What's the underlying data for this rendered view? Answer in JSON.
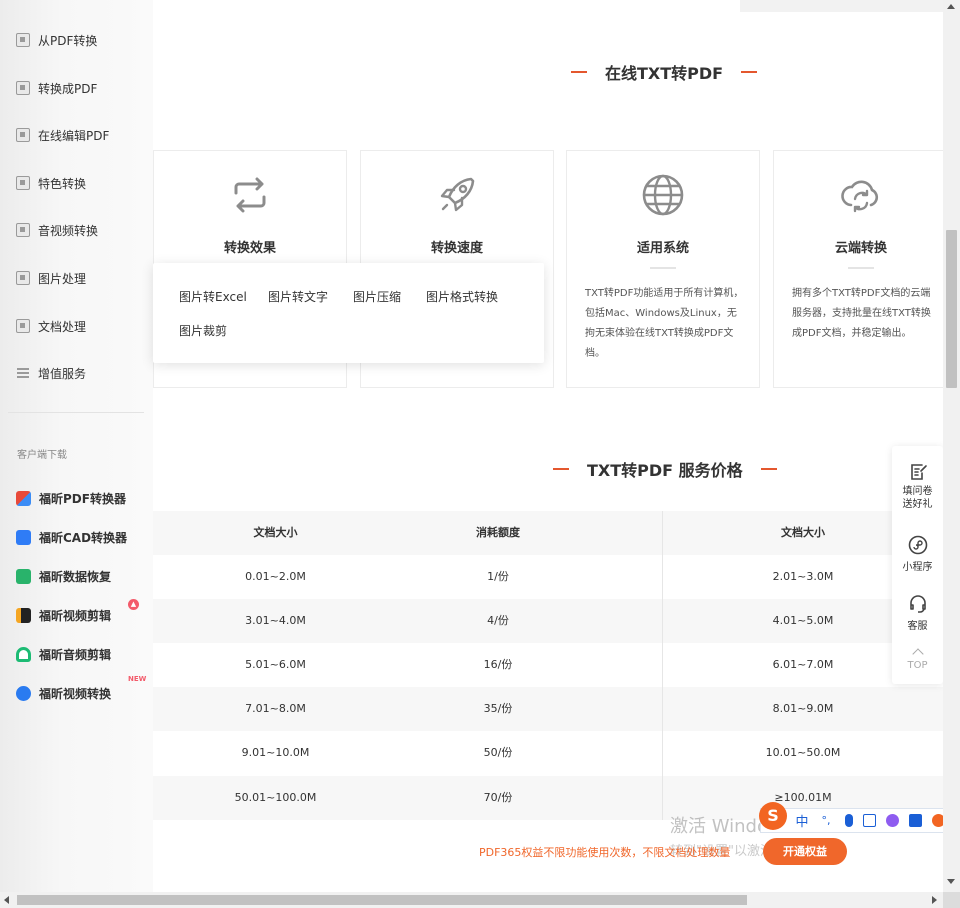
{
  "sidebar": {
    "menu": [
      {
        "label": "从PDF转换",
        "icon": "pdf-convert-icon"
      },
      {
        "label": "转换成PDF",
        "icon": "to-pdf-icon"
      },
      {
        "label": "在线编辑PDF",
        "icon": "edit-pdf-icon"
      },
      {
        "label": "特色转换",
        "icon": "special-convert-icon"
      },
      {
        "label": "音视频转换",
        "icon": "media-convert-icon"
      },
      {
        "label": "图片处理",
        "icon": "image-process-icon"
      },
      {
        "label": "文档处理",
        "icon": "document-process-icon"
      },
      {
        "label": "增值服务",
        "icon": "value-service-icon"
      }
    ],
    "download_caption": "客户端下载",
    "downloads": [
      {
        "label": "福昕PDF转换器",
        "color": "#e84a3a"
      },
      {
        "label": "福昕CAD转换器",
        "color": "#2f7cf6"
      },
      {
        "label": "福昕数据恢复",
        "color": "#29b36b"
      },
      {
        "label": "福昕视频剪辑",
        "color": "#222222",
        "badge": "hot"
      },
      {
        "label": "福昕音频剪辑",
        "color": "#1dbb74"
      },
      {
        "label": "福昕视频转换",
        "color": "#2a7bf0",
        "badge": "NEW"
      }
    ]
  },
  "section1": {
    "title": "在线TXT转PDF"
  },
  "cards": [
    {
      "title": "转换效果",
      "icon": "convert-arrows-icon",
      "desc": ""
    },
    {
      "title": "转换速度",
      "icon": "rocket-icon",
      "desc": ""
    },
    {
      "title": "适用系统",
      "icon": "globe-icon",
      "desc": "TXT转PDF功能适用于所有计算机，包括Mac、Windows及Linux，无拘无束体验在线TXT转换成PDF文档。"
    },
    {
      "title": "云端转换",
      "icon": "cloud-sync-icon",
      "desc": "拥有多个TXT转PDF文档的云端服务器，支持批量在线TXT转换成PDF文档，并稳定输出。"
    }
  ],
  "dropdown": {
    "items": [
      "图片转Excel",
      "图片转文字",
      "图片压缩",
      "图片格式转换",
      "图片裁剪"
    ]
  },
  "section2": {
    "title": "TXT转PDF 服务价格"
  },
  "price_table": {
    "headers": [
      "文档大小",
      "消耗额度",
      "文档大小"
    ],
    "rows": [
      [
        "0.01~2.0M",
        "1/份",
        "2.01~3.0M"
      ],
      [
        "3.01~4.0M",
        "4/份",
        "4.01~5.0M"
      ],
      [
        "5.01~6.0M",
        "16/份",
        "6.01~7.0M"
      ],
      [
        "7.01~8.0M",
        "35/份",
        "8.01~9.0M"
      ],
      [
        "9.01~10.0M",
        "50/份",
        "10.01~50.0M"
      ],
      [
        "50.01~100.0M",
        "70/份",
        "≥100.01M"
      ]
    ]
  },
  "promo": {
    "text": "PDF365权益不限功能使用次数，不限文档处理数量",
    "button": "开通权益"
  },
  "watermark": {
    "line1": "激活 Windows",
    "line2": "转到\"设置\"以激活 Windows。"
  },
  "float_panel": {
    "items": [
      {
        "label": "填问卷\n送好礼",
        "icon": "survey-icon"
      },
      {
        "label": "小程序",
        "icon": "mini-program-icon"
      },
      {
        "label": "客服",
        "icon": "headset-icon"
      }
    ],
    "top_label": "TOP"
  },
  "ime": {
    "logo": "S",
    "mode": "中",
    "punct": "°,"
  },
  "colors": {
    "accent": "#f0672b",
    "dash": "#e4572e"
  }
}
